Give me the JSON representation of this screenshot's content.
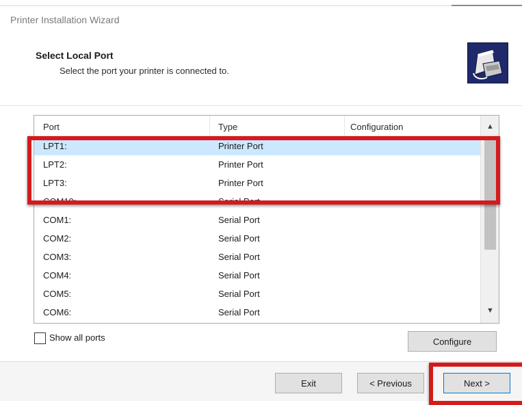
{
  "window": {
    "title": "Printer Installation Wizard"
  },
  "header": {
    "title": "Select Local Port",
    "subtitle": "Select the port your printer is connected to.",
    "icon": "printer-icon"
  },
  "port_list": {
    "columns": [
      "Port",
      "Type",
      "Configuration"
    ],
    "rows": [
      {
        "port": "LPT1:",
        "type": "Printer Port",
        "configuration": ""
      },
      {
        "port": "LPT2:",
        "type": "Printer Port",
        "configuration": ""
      },
      {
        "port": "LPT3:",
        "type": "Printer Port",
        "configuration": ""
      },
      {
        "port": "COM10:",
        "type": "Serial Port",
        "configuration": ""
      },
      {
        "port": "COM1:",
        "type": "Serial Port",
        "configuration": ""
      },
      {
        "port": "COM2:",
        "type": "Serial Port",
        "configuration": ""
      },
      {
        "port": "COM3:",
        "type": "Serial Port",
        "configuration": ""
      },
      {
        "port": "COM4:",
        "type": "Serial Port",
        "configuration": ""
      },
      {
        "port": "COM5:",
        "type": "Serial Port",
        "configuration": ""
      },
      {
        "port": "COM6:",
        "type": "Serial Port",
        "configuration": ""
      }
    ],
    "selected_index": 0
  },
  "options": {
    "show_all_ports_label": "Show all ports",
    "show_all_ports_checked": false
  },
  "buttons": {
    "configure": "Configure",
    "exit": "Exit",
    "previous": "< Previous",
    "next": "Next >"
  },
  "colors": {
    "highlight": "#d41a1a",
    "selection": "#cce8ff",
    "accent": "#0078d7"
  }
}
